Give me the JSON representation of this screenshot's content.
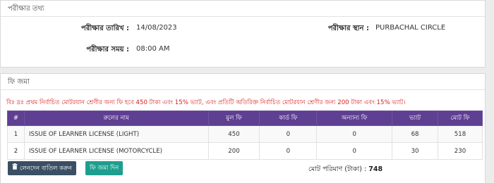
{
  "exam_info": {
    "heading": "পরীক্ষার তথ্য",
    "date_label": "পরীক্ষার তারিখ :",
    "date_value": "14/08/2023",
    "place_label": "পরীক্ষার স্থান :",
    "place_value": "PURBACHAL CIRCLE",
    "time_label": "পরীক্ষার সময় :",
    "time_value": "08:00 AM"
  },
  "fee": {
    "heading": "ফি জমা",
    "notice": "বিঃ দ্রঃ প্রথম নির্বাচিত মোটরযান শ্রেণীর জন্য ফি হবে 450 টাকা এবং 15% ভ্যাট, এবং প্রতিটি অতিরিক্ত নির্বাচিত মোটরযান শ্রেণীর জন্য 200 টাকা এবং 15% ভ্যাট।",
    "columns": [
      "#",
      "রুলের নাম",
      "মুল ফি",
      "কার্ড ফি",
      "অন্যান্য ফি",
      "ভ্যাট",
      "মোট ফি"
    ],
    "rows": [
      {
        "no": "1",
        "name": "ISSUE OF LEARNER LICENSE (LIGHT)",
        "base_fee": "450",
        "card_fee": "0",
        "other_fee": "0",
        "vat": "68",
        "total": "518"
      },
      {
        "no": "2",
        "name": "ISSUE OF LEARNER LICENSE (MOTORCYCLE)",
        "base_fee": "200",
        "card_fee": "0",
        "other_fee": "0",
        "vat": "30",
        "total": "230"
      }
    ],
    "cancel_button": "লেনদেন বাতিল করুন",
    "pay_button": "ফি জমা দিন",
    "total_label": "মোট পরিমাণ (টাকা) :",
    "total_value": "748"
  },
  "colors": {
    "table_header": "#5e3f92",
    "notice_text": "#d81e1e",
    "cancel_button": "#3a4f63",
    "pay_button": "#1e9e8e"
  },
  "icons": {
    "cancel_button_icon": "trash-icon"
  }
}
